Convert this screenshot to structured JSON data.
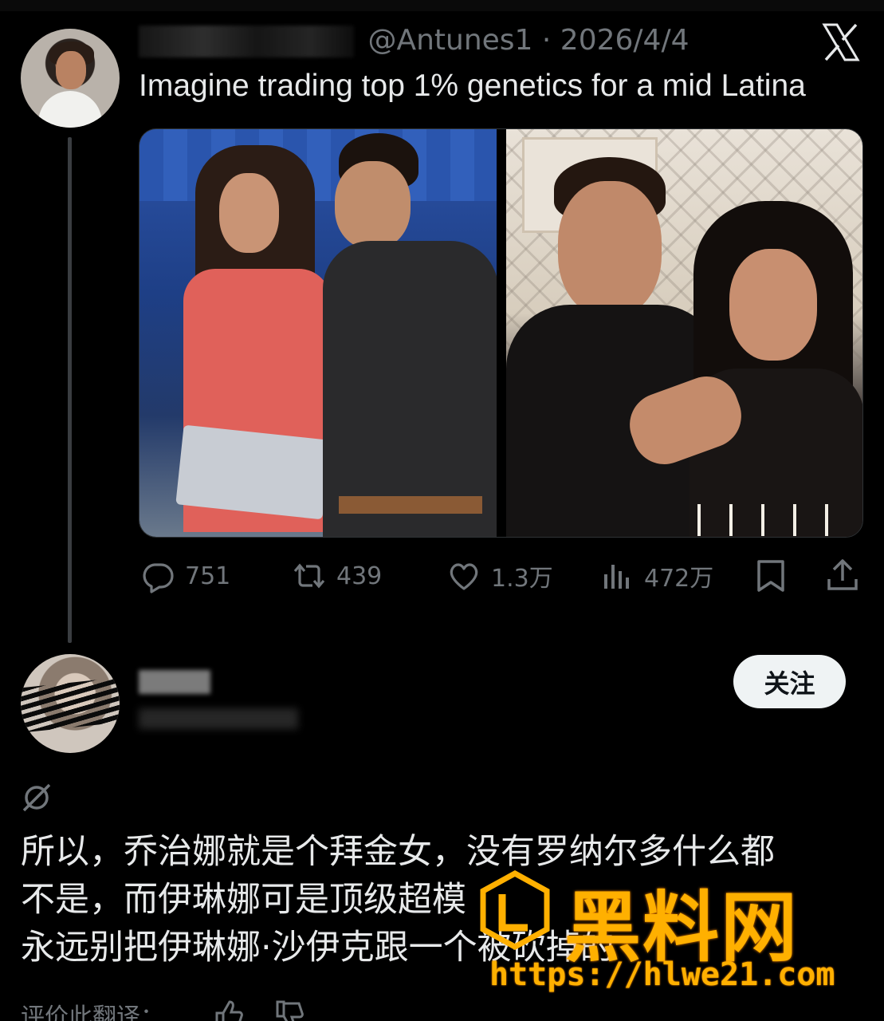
{
  "tweet": {
    "date": "2026/4/4",
    "handle_partial": "@Antunes1 ·",
    "text": "Imagine trading top 1% genetics for a mid Latina",
    "stats": {
      "replies": "751",
      "retweets": "439",
      "likes": "1.3万",
      "views": "472万"
    }
  },
  "reply": {
    "follow_label": "关注",
    "lines": [
      "所以，乔治娜就是个拜金女，没有罗纳尔多什么都",
      "不是，而伊琳娜可是顶级超模",
      "永远别把伊琳娜·沙伊克跟一个被砍掉的"
    ],
    "translate_prompt": "评价此翻译："
  },
  "watermark": {
    "title": "黑料网",
    "url": "https://hlwe21.com",
    "color": "#ffb000"
  },
  "colors": {
    "background": "#000000",
    "text": "#e7e9ea",
    "muted": "#71767b"
  }
}
